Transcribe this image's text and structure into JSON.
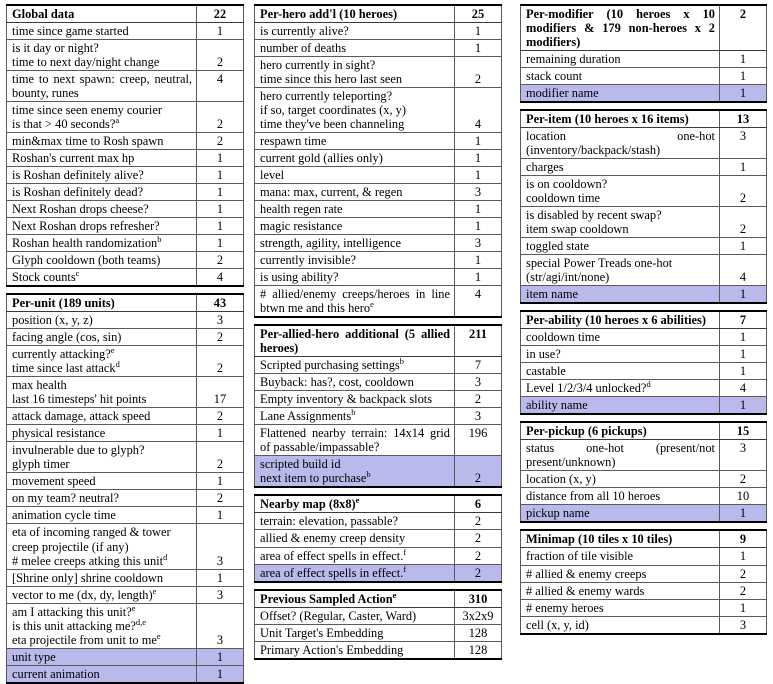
{
  "document": {
    "title": "Dota 2 observation space feature tables",
    "highlight_color": "#b9b9ec",
    "rule_color": "#000000"
  },
  "tables": [
    {
      "id": "global-data",
      "column": 1,
      "header": {
        "label": "Global data",
        "value": "22"
      },
      "rows": [
        {
          "lines": [
            "time since game started"
          ],
          "value": "1"
        },
        {
          "lines": [
            "is it day or night?",
            "time to next day/night change"
          ],
          "value": "2"
        },
        {
          "lines": [
            "time to next spawn: creep, neutral, bounty, runes"
          ],
          "value": "4",
          "justify": true
        },
        {
          "lines": [
            "time since seen enemy courier",
            "is that > 40 seconds?^a"
          ],
          "value": "2"
        },
        {
          "lines": [
            "min&max time to Rosh spawn"
          ],
          "value": "2"
        },
        {
          "lines": [
            "Roshan's current max hp"
          ],
          "value": "1"
        },
        {
          "lines": [
            "is Roshan definitely alive?"
          ],
          "value": "1"
        },
        {
          "lines": [
            "is Roshan definitely dead?"
          ],
          "value": "1"
        },
        {
          "lines": [
            "Next Roshan drops cheese?"
          ],
          "value": "1"
        },
        {
          "lines": [
            "Next Roshan drops refresher?"
          ],
          "value": "1"
        },
        {
          "lines": [
            "Roshan health randomization^b"
          ],
          "value": "1"
        },
        {
          "lines": [
            "Glyph cooldown (both teams)"
          ],
          "value": "2"
        },
        {
          "lines": [
            "Stock counts^c"
          ],
          "value": "4"
        }
      ]
    },
    {
      "id": "per-unit",
      "column": 1,
      "header": {
        "label": "Per-unit (189 units)",
        "value": "43"
      },
      "rows": [
        {
          "lines": [
            "position (x, y, z)"
          ],
          "value": "3"
        },
        {
          "lines": [
            "facing angle (cos, sin)"
          ],
          "value": "2"
        },
        {
          "lines": [
            "currently attacking?^e",
            "time since last attack^d"
          ],
          "value": "2"
        },
        {
          "lines": [
            "max health",
            "last 16 timesteps' hit points"
          ],
          "value": "17"
        },
        {
          "lines": [
            "attack damage, attack speed"
          ],
          "value": "2"
        },
        {
          "lines": [
            "physical resistance"
          ],
          "value": "1"
        },
        {
          "lines": [
            "invulnerable due to glyph?",
            "glyph timer"
          ],
          "value": "2"
        },
        {
          "lines": [
            "movement speed"
          ],
          "value": "1"
        },
        {
          "lines": [
            "on my team? neutral?"
          ],
          "value": "2"
        },
        {
          "lines": [
            "animation cycle time"
          ],
          "value": "1"
        },
        {
          "lines": [
            "eta of incoming ranged & tower",
            "creep projectile (if any)",
            "# melee creeps atking this unit^d"
          ],
          "value": "3"
        },
        {
          "lines": [
            "[Shrine only] shrine cooldown"
          ],
          "value": "1"
        },
        {
          "lines": [
            "vector to me (dx, dy, length)^e"
          ],
          "value": "3"
        },
        {
          "lines": [
            "am I attacking this unit?^e",
            "is this unit attacking me?^d,e",
            "eta projectile from unit to me^e"
          ],
          "value": "3"
        },
        {
          "lines": [
            "unit type"
          ],
          "value": "1",
          "highlight": true
        },
        {
          "lines": [
            "current animation"
          ],
          "value": "1",
          "highlight": true
        }
      ]
    },
    {
      "id": "per-hero-addl",
      "column": 2,
      "header": {
        "label": "Per-hero add'l (10 heroes)",
        "value": "25"
      },
      "rows": [
        {
          "lines": [
            "is currently alive?"
          ],
          "value": "1"
        },
        {
          "lines": [
            "number of deaths"
          ],
          "value": "1"
        },
        {
          "lines": [
            "hero currently in sight?",
            "time since this hero last seen"
          ],
          "value": "2"
        },
        {
          "lines": [
            "hero currently teleporting?",
            "if so, target coordinates (x, y)",
            "time they've been channeling"
          ],
          "value": "4"
        },
        {
          "lines": [
            "respawn time"
          ],
          "value": "1"
        },
        {
          "lines": [
            "current gold (allies only)"
          ],
          "value": "1"
        },
        {
          "lines": [
            "level"
          ],
          "value": "1"
        },
        {
          "lines": [
            "mana: max, current, & regen"
          ],
          "value": "3"
        },
        {
          "lines": [
            "health regen rate"
          ],
          "value": "1"
        },
        {
          "lines": [
            "magic resistance"
          ],
          "value": "1"
        },
        {
          "lines": [
            "strength, agility, intelligence"
          ],
          "value": "3"
        },
        {
          "lines": [
            "currently invisible?"
          ],
          "value": "1"
        },
        {
          "lines": [
            "is using ability?"
          ],
          "value": "1"
        },
        {
          "lines": [
            "# allied/enemy creeps/heroes in line btwn me and this hero^e"
          ],
          "value": "4",
          "justify": true
        }
      ]
    },
    {
      "id": "per-allied-hero",
      "column": 2,
      "header": {
        "label": "Per-allied-hero additional (5 allied heroes)",
        "value": "211",
        "justify": true
      },
      "rows": [
        {
          "lines": [
            "Scripted purchasing settings^b"
          ],
          "value": "7"
        },
        {
          "lines": [
            "Buyback: has?, cost, cooldown"
          ],
          "value": "3"
        },
        {
          "lines": [
            "Empty inventory & backpack slots"
          ],
          "value": "2",
          "justify": true
        },
        {
          "lines": [
            "Lane Assignments^b"
          ],
          "value": "3"
        },
        {
          "lines": [
            "Flattened nearby terrain: 14x14 grid of passable/impassable?"
          ],
          "value": "196",
          "justify": true
        },
        {
          "lines": [
            "scripted build id",
            "next item to purchase^b"
          ],
          "value": "2",
          "highlight": true
        }
      ]
    },
    {
      "id": "nearby-map",
      "column": 2,
      "header": {
        "label": "Nearby map (8x8)^e",
        "value": "6"
      },
      "rows": [
        {
          "lines": [
            "terrain: elevation, passable?"
          ],
          "value": "2"
        },
        {
          "lines": [
            "allied & enemy creep density"
          ],
          "value": "2"
        },
        {
          "lines": [
            "area of effect spells in effect.^f"
          ],
          "value": "2"
        },
        {
          "lines": [
            "area of effect spells in effect.^f"
          ],
          "value": "2",
          "highlight": true
        }
      ]
    },
    {
      "id": "previous-sampled-action",
      "column": 2,
      "header": {
        "label": "Previous Sampled Action^e",
        "value": "310"
      },
      "rows": [
        {
          "lines": [
            "Offset? (Regular, Caster, Ward)"
          ],
          "value": "3x2x9",
          "justify": true
        },
        {
          "lines": [
            "Unit Target's Embedding"
          ],
          "value": "128"
        },
        {
          "lines": [
            "Primary Action's Embedding"
          ],
          "value": "128"
        }
      ]
    },
    {
      "id": "per-modifier",
      "column": 3,
      "header": {
        "label": "Per-modifier (10 heroes x 10 modifiers & 179 non-heroes x 2 modifiers)",
        "value": "2",
        "justify": true
      },
      "rows": [
        {
          "lines": [
            "remaining duration"
          ],
          "value": "1"
        },
        {
          "lines": [
            "stack count"
          ],
          "value": "1"
        },
        {
          "lines": [
            "modifier name"
          ],
          "value": "1",
          "highlight": true
        }
      ]
    },
    {
      "id": "per-item",
      "column": 3,
      "header": {
        "label": "Per-item (10 heroes x 16 items)",
        "value": "13",
        "justify": true
      },
      "rows": [
        {
          "lines": [
            "location one-hot (inventory/backpack/stash)"
          ],
          "value": "3",
          "justify": true
        },
        {
          "lines": [
            "charges"
          ],
          "value": "1"
        },
        {
          "lines": [
            "is on cooldown?",
            "cooldown time"
          ],
          "value": "2"
        },
        {
          "lines": [
            "is disabled by recent swap?",
            "item swap cooldown"
          ],
          "value": "2"
        },
        {
          "lines": [
            "toggled state"
          ],
          "value": "1"
        },
        {
          "lines": [
            "special Power Treads one-hot",
            "(str/agi/int/none)"
          ],
          "value": "4"
        },
        {
          "lines": [
            "item name"
          ],
          "value": "1",
          "highlight": true
        }
      ]
    },
    {
      "id": "per-ability",
      "column": 3,
      "header": {
        "label": "Per-ability (10 heroes x 6 abilities)",
        "value": "7",
        "justify": true
      },
      "rows": [
        {
          "lines": [
            "cooldown time"
          ],
          "value": "1"
        },
        {
          "lines": [
            "in use?"
          ],
          "value": "1"
        },
        {
          "lines": [
            "castable"
          ],
          "value": "1"
        },
        {
          "lines": [
            "Level 1/2/3/4 unlocked?^d"
          ],
          "value": "4"
        },
        {
          "lines": [
            "ability name"
          ],
          "value": "1",
          "highlight": true
        }
      ]
    },
    {
      "id": "per-pickup",
      "column": 3,
      "header": {
        "label": "Per-pickup (6 pickups)",
        "value": "15"
      },
      "rows": [
        {
          "lines": [
            "status one-hot (present/not present/unknown)"
          ],
          "value": "3",
          "justify": true
        },
        {
          "lines": [
            "location (x, y)"
          ],
          "value": "2"
        },
        {
          "lines": [
            "distance from all 10 heroes"
          ],
          "value": "10"
        },
        {
          "lines": [
            "pickup name"
          ],
          "value": "1",
          "highlight": true
        }
      ]
    },
    {
      "id": "minimap",
      "column": 3,
      "header": {
        "label": "Minimap (10 tiles x 10 tiles)",
        "value": "9",
        "justify": true
      },
      "rows": [
        {
          "lines": [
            "fraction of tile visible"
          ],
          "value": "1"
        },
        {
          "lines": [
            "# allied & enemy creeps"
          ],
          "value": "2"
        },
        {
          "lines": [
            "# allied & enemy wards"
          ],
          "value": "2"
        },
        {
          "lines": [
            "# enemy heroes"
          ],
          "value": "1"
        },
        {
          "lines": [
            "cell (x, y, id)"
          ],
          "value": "3"
        }
      ]
    }
  ]
}
